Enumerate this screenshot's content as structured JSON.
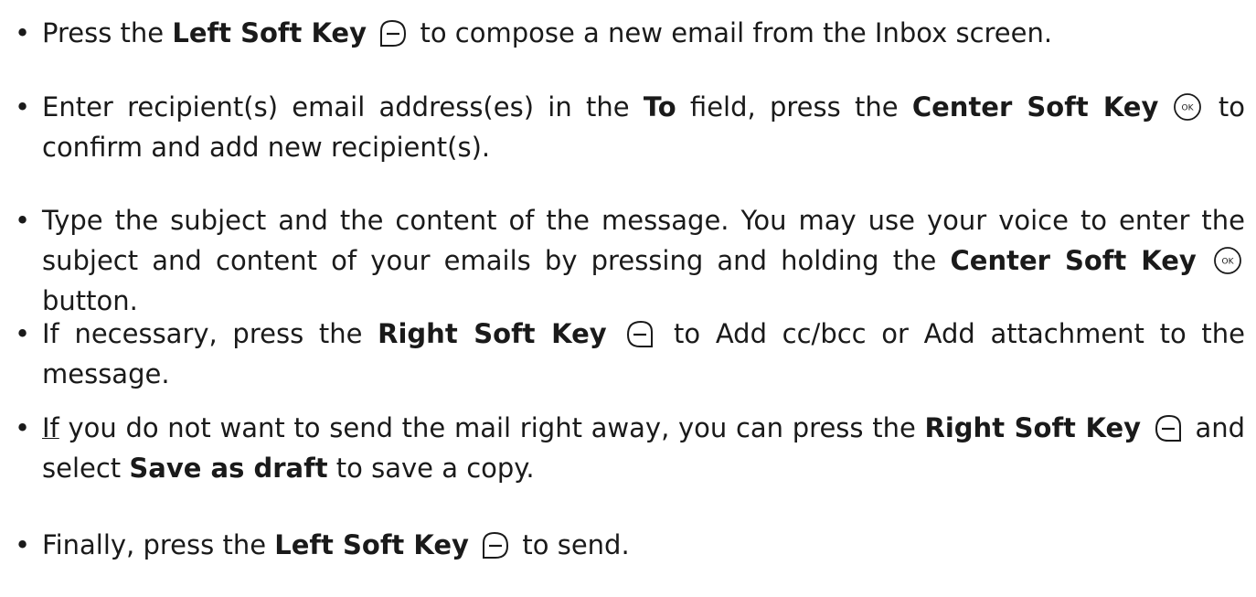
{
  "bullets": {
    "b1": {
      "t1": "Press the ",
      "k1": "Left Soft Key",
      "t2": " to compose a new email from the Inbox screen."
    },
    "b2": {
      "t1": "Enter recipient(s) email address(es) in the ",
      "k1": "To",
      "t2": " field, press the ",
      "k2": "Center Soft Key",
      "t3": " to confirm and add new recipient(s)."
    },
    "b3": {
      "t1": "Type the subject and the content of the message. You may use your voice to enter the subject and content of your emails by pressing and holding the ",
      "k1": "Center Soft Key",
      "t2": " button."
    },
    "b4": {
      "t1": "If necessary, press the ",
      "k1": "Right Soft Key",
      "t2": " to Add cc/bcc or Add attachment to the message."
    },
    "b5": {
      "t0": "If",
      "t1": " you do not want to send the mail right away, you can press the ",
      "k1": "Right Soft Key",
      "t2": " and select ",
      "k2": "Save as draft",
      "t3": " to save a copy."
    },
    "b6": {
      "t1": "Finally, press the ",
      "k1": "Left Soft Key",
      "t2": " to send."
    }
  },
  "icons": {
    "left_soft_key": "left-soft-key-icon",
    "center_soft_key": "ok-key-icon",
    "right_soft_key": "right-soft-key-icon",
    "center_key_label": "OK"
  },
  "colors": {
    "text": "#1a1a1a",
    "background": "#ffffff"
  }
}
